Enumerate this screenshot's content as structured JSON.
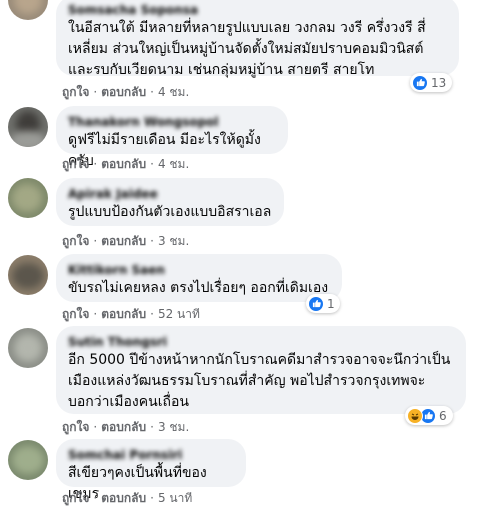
{
  "comments": [
    {
      "author": "Somsacha Soponsa",
      "lines": [
        "ในอีสานใต้ มีหลายที่หลายรูปแบบเลย วงกลม วงรี ครึ่งวงรี สี่",
        "เหลี่ยม ส่วนใหญ่เป็นหมู่บ้านจัดตั้งใหม่สมัยปราบคอมมิวนิสต์",
        "และรบกับเวียดนาม เช่นกลุ่มหมู่บ้าน สายตรี สายโท"
      ],
      "like": "ถูกใจ",
      "reply": "ตอบกลับ",
      "time": "4 ชม.",
      "reaction_count": "13"
    },
    {
      "author": "Thanakorn Wongsopol",
      "lines": [
        "ดูฟรีไม่มีรายเดือน มีอะไรให้ดูมั้งครับ"
      ],
      "like": "ถูกใจ",
      "reply": "ตอบกลับ",
      "time": "4 ชม."
    },
    {
      "author": "Apirak Jaidee",
      "lines": [
        "รูปแบบป้องกันตัวเองแบบอิสราเอล"
      ],
      "like": "ถูกใจ",
      "reply": "ตอบกลับ",
      "time": "3 ชม."
    },
    {
      "author": "Kittikorn Saen",
      "lines": [
        "ขับรถไม่เคยหลง ตรงไปเรื่อยๆ ออกที่เดิมเอง"
      ],
      "like": "ถูกใจ",
      "reply": "ตอบกลับ",
      "time": "52 นาที",
      "reaction_count": "1"
    },
    {
      "author": "Sutin Thongsri",
      "lines": [
        "อีก 5000 ปีข้างหน้าหากนักโบราณคดีมาสำรวจอาจจะนึกว่าเป็น",
        "เมืองแหล่งวัฒนธรรมโบราณที่สำคัญ พอไปสำรวจกรุงเทพจะ",
        "บอกว่าเมืองคนเถื่อน"
      ],
      "like": "ถูกใจ",
      "reply": "ตอบกลับ",
      "time": "3 ชม.",
      "reaction_count": "6"
    },
    {
      "author": "Somchai Pornsiri",
      "lines": [
        "สีเขียวๆคงเป็นพื้นที่ของเขมร"
      ],
      "like": "ถูกใจ",
      "reply": "ตอบกลับ",
      "time": "5 นาที"
    }
  ],
  "colors": {
    "bubble": "#f0f2f5",
    "meta": "#65676b",
    "like_blue": "#1877f2",
    "haha_yellow": "#f7b125"
  }
}
